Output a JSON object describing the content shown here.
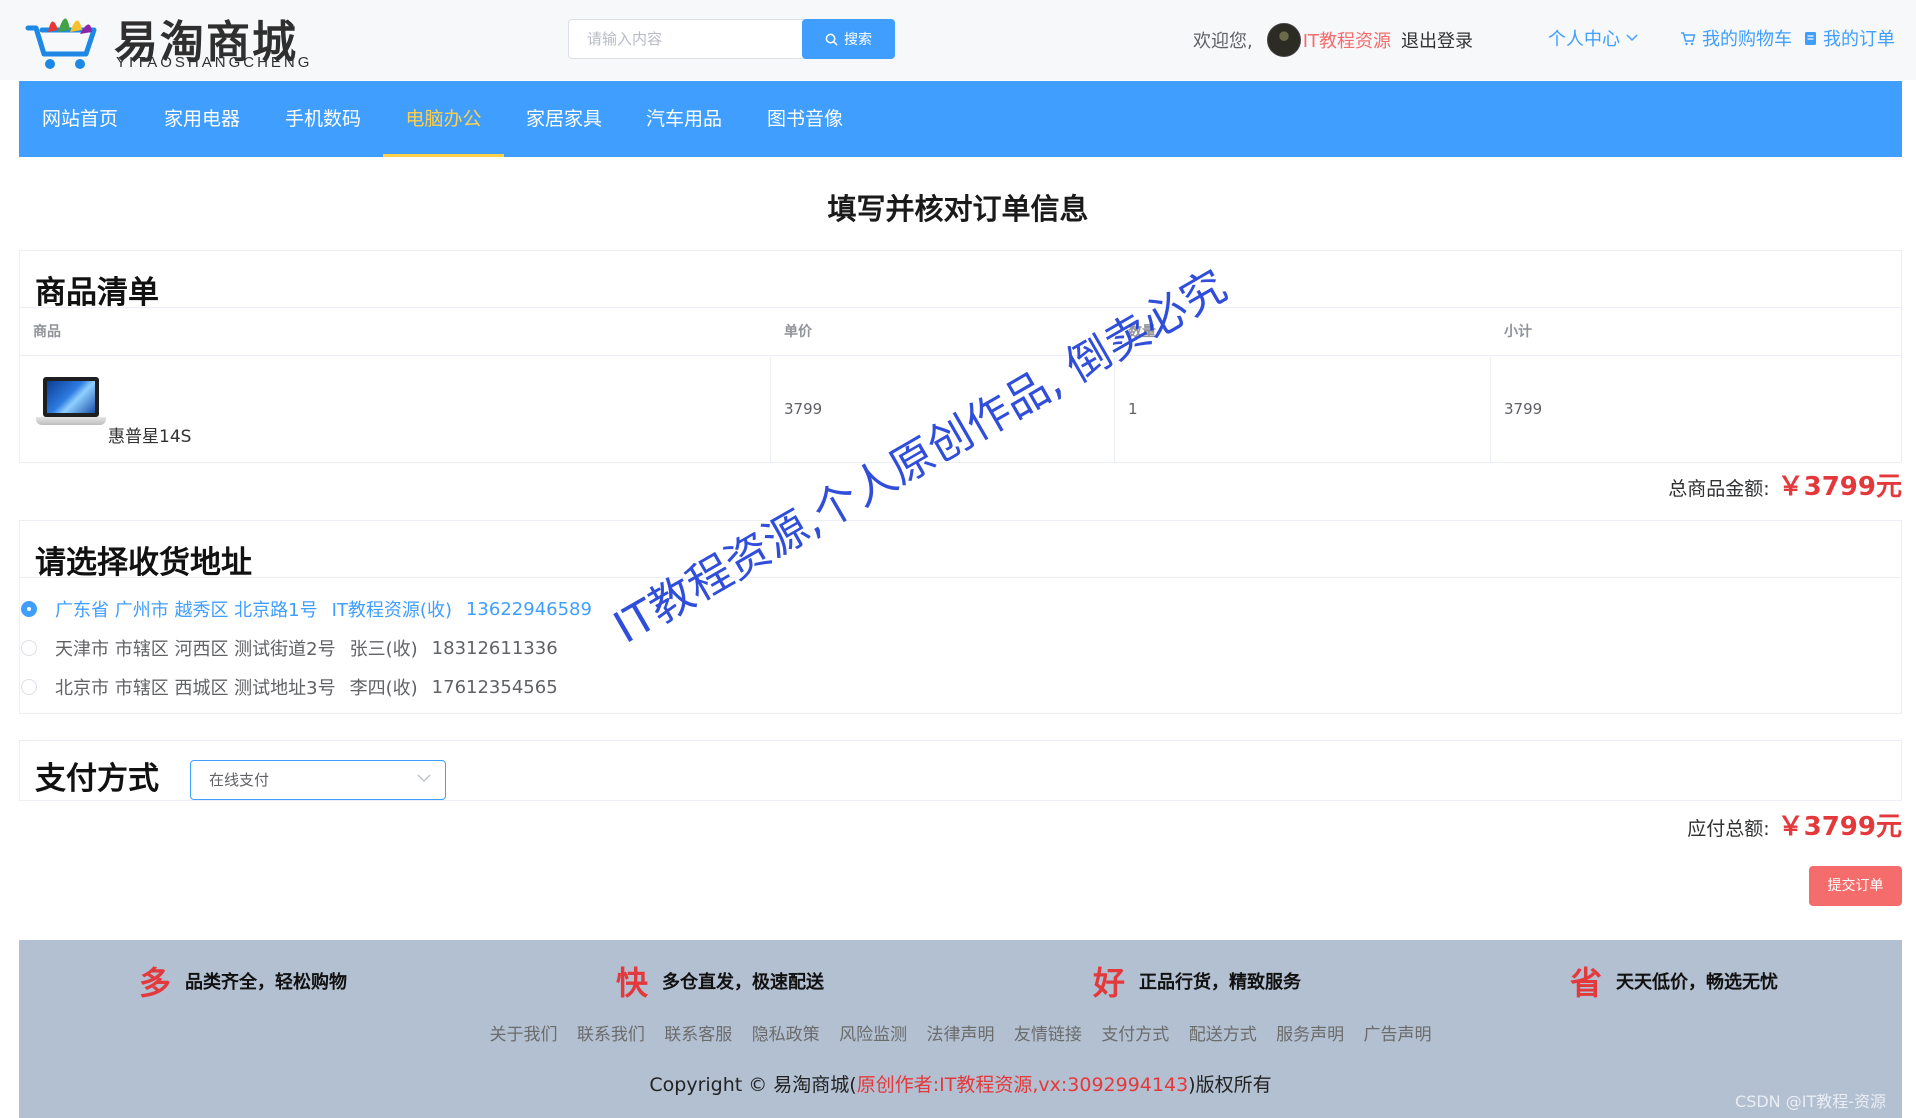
{
  "header": {
    "logo_title": "易淘商城",
    "logo_sub": "YITAOSHANGCHENG",
    "search_placeholder": "请输入内容",
    "search_button": "搜索",
    "welcome": "欢迎您,",
    "username": "IT教程资源",
    "logout": "退出登录",
    "personal_center": "个人中心",
    "cart": "我的购物车",
    "orders": "我的订单"
  },
  "nav": {
    "items": [
      "网站首页",
      "家用电器",
      "手机数码",
      "电脑办公",
      "家居家具",
      "汽车用品",
      "图书音像"
    ],
    "active_index": 3
  },
  "page_title": "填写并核对订单信息",
  "products": {
    "heading": "商品清单",
    "columns": [
      "商品",
      "单价",
      "数量",
      "小计"
    ],
    "rows": [
      {
        "name": "惠普星14S",
        "price": "3799",
        "qty": "1",
        "subtotal": "3799"
      }
    ],
    "total_label": "总商品金额:",
    "total_value": "￥3799元"
  },
  "address": {
    "heading": "请选择收货地址",
    "options": [
      {
        "region": "广东省 广州市 越秀区 北京路1号",
        "receiver": "IT教程资源(收)",
        "phone": "13622946589",
        "selected": true
      },
      {
        "region": "天津市 市辖区 河西区 测试街道2号",
        "receiver": "张三(收)",
        "phone": "18312611336",
        "selected": false
      },
      {
        "region": "北京市 市辖区 西城区 测试地址3号",
        "receiver": "李四(收)",
        "phone": "17612354565",
        "selected": false
      }
    ]
  },
  "payment": {
    "heading": "支付方式",
    "selected": "在线支付"
  },
  "order": {
    "payable_label": "应付总额:",
    "payable_value": "￥3799元",
    "submit": "提交订单"
  },
  "watermark": "IT教程资源,个人原创作品, 倒卖必究",
  "footer": {
    "features": [
      {
        "big": "多",
        "text": "品类齐全，轻松购物"
      },
      {
        "big": "快",
        "text": "多仓直发，极速配送"
      },
      {
        "big": "好",
        "text": "正品行货，精致服务"
      },
      {
        "big": "省",
        "text": "天天低价，畅选无忧"
      }
    ],
    "links": [
      "关于我们",
      "联系我们",
      "联系客服",
      "隐私政策",
      "风险监测",
      "法律声明",
      "友情链接",
      "支付方式",
      "配送方式",
      "服务声明",
      "广告声明"
    ],
    "copyright_prefix": "Copyright © 易淘商城(",
    "copyright_author": "原创作者:IT教程资源,vx:3092994143",
    "copyright_suffix": ")版权所有",
    "csdn": "CSDN @IT教程-资源"
  },
  "colors": {
    "primary": "#409eff",
    "nav_active": "#ffd04b",
    "price_red": "#e4393c",
    "danger": "#f56c6c",
    "footer_bg": "#b3c0d1"
  }
}
